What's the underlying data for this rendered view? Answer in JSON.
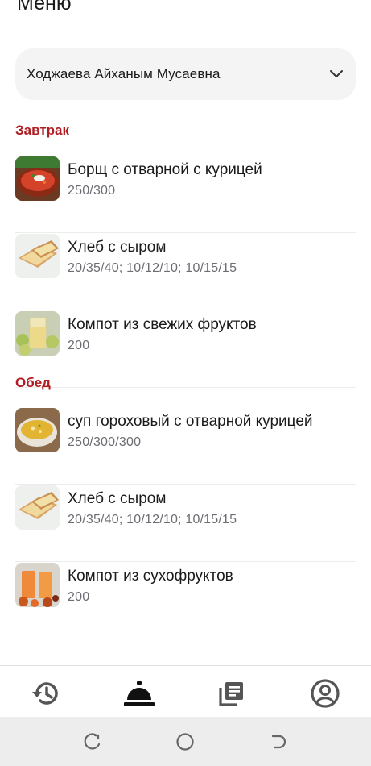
{
  "header": {
    "title": "Меню"
  },
  "selector": {
    "value": "Ходжаева Айханым Мусаевна",
    "icon": "chevron-down-icon"
  },
  "sections": [
    {
      "title": "Завтрак",
      "items": [
        {
          "name": "Борщ с отварной с курицей",
          "portion": "250/300",
          "image": "borscht-image"
        },
        {
          "name": "Хлеб с сыром",
          "portion": "20/35/40; 10/12/10; 10/15/15",
          "image": "bread-cheese-image"
        },
        {
          "name": "Компот из свежих фруктов",
          "portion": "200",
          "image": "fruit-compote-image"
        }
      ]
    },
    {
      "title": "Обед",
      "items": [
        {
          "name": "суп гороховый с отварной курицей",
          "portion": "250/300/300",
          "image": "pea-soup-image"
        },
        {
          "name": "Хлеб с сыром",
          "portion": "20/35/40; 10/12/10; 10/15/15",
          "image": "bread-cheese-image"
        },
        {
          "name": "Компот из сухофруктов",
          "portion": "200",
          "image": "dried-fruit-compote-image"
        }
      ]
    }
  ],
  "bottom_nav": [
    {
      "icon": "history-icon",
      "active": false
    },
    {
      "icon": "service-bell-icon",
      "active": true
    },
    {
      "icon": "news-icon",
      "active": false
    },
    {
      "icon": "account-icon",
      "active": false
    }
  ],
  "system_nav": [
    "recent-apps-icon",
    "home-icon",
    "back-icon"
  ],
  "colors": {
    "accent": "#b01c22",
    "secondary_text": "#6c6c73",
    "nav_icon": "#555555",
    "active_icon": "#111111"
  }
}
